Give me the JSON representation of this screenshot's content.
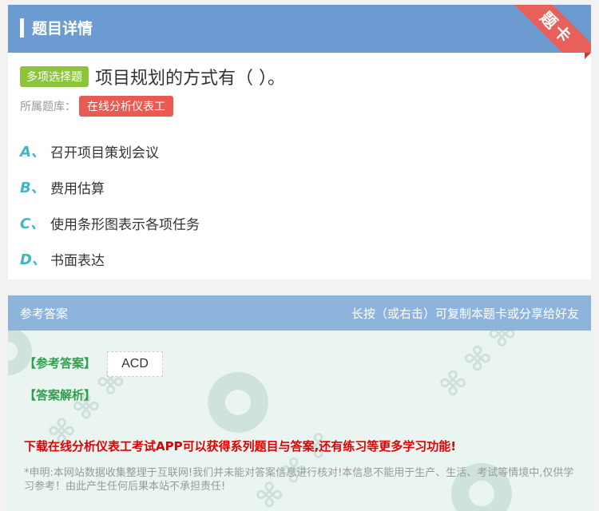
{
  "header": {
    "title": "题目详情",
    "ribbon": "题卡"
  },
  "question": {
    "type_tag": "多项选择题",
    "text": "项目规划的方式有（ ）。",
    "bank_label": "所属题库：",
    "bank_name": "在线分析仪表工"
  },
  "options": [
    {
      "letter": "A、",
      "text": "召开项目策划会议"
    },
    {
      "letter": "B、",
      "text": "费用估算"
    },
    {
      "letter": "C、",
      "text": "使用条形图表示各项任务"
    },
    {
      "letter": "D、",
      "text": "书面表达"
    }
  ],
  "answer": {
    "section_title": "参考答案",
    "copy_hint": "长按（或右击）可复制本题卡或分享给好友",
    "answer_label": "【参考答案】",
    "answer_value": "ACD",
    "analysis_label": "【答案解析】",
    "promo": "下载在线分析仪表工考试APP可以获得系列题目与答案,还有练习等更多学习功能!",
    "disclaimer": "*申明:本网站数据收集整理于互联网!我们并未能对答案信息进行核对!本信息不能用于生产、生活、考试等情境中,仅供学习参考！由此产生任何后果本站不承担责任!"
  },
  "colors": {
    "header_bg": "#6b9bd0",
    "type_tag_bg": "#8cc43c",
    "bank_tag_bg": "#e85a52",
    "option_letter": "#3ab7c8",
    "answer_label": "#2fa04a",
    "promo_text": "#e00000"
  }
}
